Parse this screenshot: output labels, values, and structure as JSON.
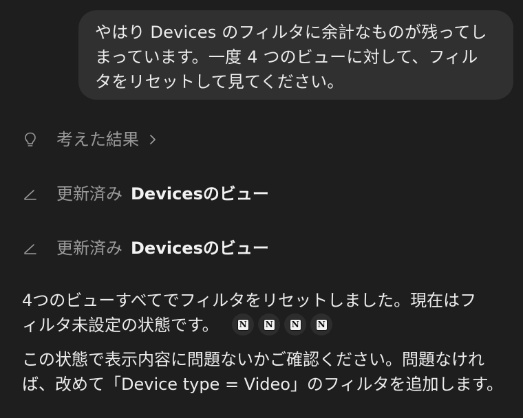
{
  "user_message": {
    "line1": "やはり Devices のフィルタに余計なものが残ってし",
    "line2": "まっています。一度 4 つのビューに対して、フィル",
    "line3": "タをリセットして見てください。"
  },
  "thinking": {
    "label": "考えた結果"
  },
  "steps": [
    {
      "action": "更新済み",
      "target": "Devicesのビュー"
    },
    {
      "action": "更新済み",
      "target": "Devicesのビュー"
    }
  ],
  "reply": {
    "para1_line1": "4つのビューすべてでフィルタをリセットしました。現在はフ",
    "para1_line2": "ィルタ未設定の状態です。",
    "para2_line1": "この状態で表示内容に問題ないかご確認ください。問題なけれ",
    "para2_line2": "ば、改めて「Device type = Video」のフィルタを追加します。"
  },
  "source_icons": [
    {
      "name": "notion-icon",
      "glyph": "N"
    },
    {
      "name": "notion-icon",
      "glyph": "N"
    },
    {
      "name": "notion-icon",
      "glyph": "N"
    },
    {
      "name": "notion-icon",
      "glyph": "N"
    }
  ],
  "colors": {
    "background": "#1e1e1e",
    "bubble": "#303030",
    "muted_text": "#9a9a9a",
    "text": "#ececec"
  }
}
